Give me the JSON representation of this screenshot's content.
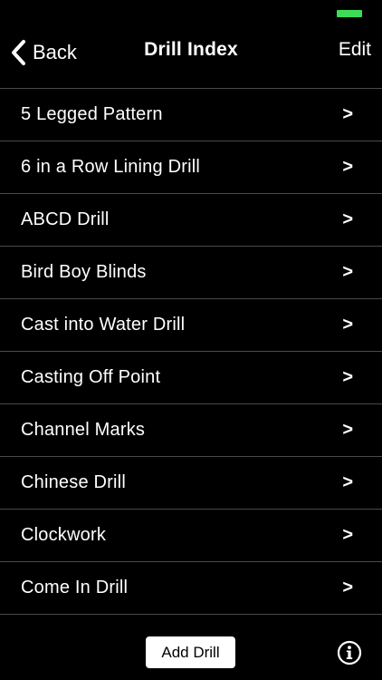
{
  "status_bar": {
    "battery_color": "#3ddc56"
  },
  "nav": {
    "back_label": "Back",
    "back_icon": "chevron-left-icon",
    "title": "Drill Index",
    "edit_label": "Edit"
  },
  "drills": [
    {
      "label": "5 Legged Pattern",
      "arrow": ">"
    },
    {
      "label": "6 in a Row Lining Drill",
      "arrow": ">"
    },
    {
      "label": "ABCD Drill",
      "arrow": ">"
    },
    {
      "label": "Bird Boy Blinds",
      "arrow": ">"
    },
    {
      "label": "Cast into Water Drill",
      "arrow": ">"
    },
    {
      "label": "Casting Off Point",
      "arrow": ">"
    },
    {
      "label": "Channel Marks",
      "arrow": ">"
    },
    {
      "label": "Chinese Drill",
      "arrow": ">"
    },
    {
      "label": "Clockwork",
      "arrow": ">"
    },
    {
      "label": "Come In Drill",
      "arrow": ">"
    }
  ],
  "footer": {
    "add_drill_label": "Add Drill",
    "info_icon": "info-circle-icon"
  },
  "colors": {
    "background": "#000000",
    "text": "#ffffff",
    "divider": "#4a4a4a"
  }
}
